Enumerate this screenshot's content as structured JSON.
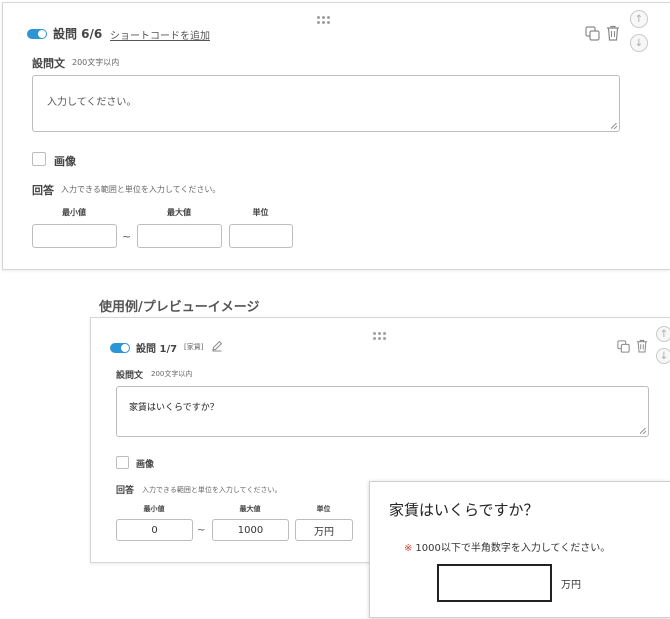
{
  "editor": {
    "question_label": "設問 6/6",
    "shortcode_link": "ショートコードを追加",
    "question_text_label": "設問文",
    "question_text_hint": "200文字以内",
    "question_text_placeholder": "入力してください。",
    "image_label": "画像",
    "answer_label": "回答",
    "answer_hint": "入力できる範囲と単位を入力してください。",
    "min_label": "最小値",
    "max_label": "最大値",
    "unit_label": "単位",
    "min_value": "",
    "max_value": "",
    "unit_value": "",
    "range_separator": "~"
  },
  "example_title": "使用例/プレビューイメージ",
  "example": {
    "question_label": "設問 1/7",
    "tag": "[家賃]",
    "question_text_label": "設問文",
    "question_text_hint": "200文字以内",
    "question_text_value": "家賃はいくらですか？",
    "image_label": "画像",
    "answer_label": "回答",
    "answer_hint": "入力できる範囲と単位を入力してください。",
    "min_label": "最小値",
    "max_label": "最大値",
    "unit_label": "単位",
    "min_value": "0",
    "max_value": "1000",
    "unit_value": "万円",
    "range_separator": "~"
  },
  "preview": {
    "question": "家賃はいくらですか？",
    "required_mark": "※",
    "note": "1000以下で半角数字を入力してください。",
    "answer_value": "",
    "unit": "万円"
  },
  "colors": {
    "toggle_on": "#2b95d6",
    "required_mark": "#e0403a"
  }
}
